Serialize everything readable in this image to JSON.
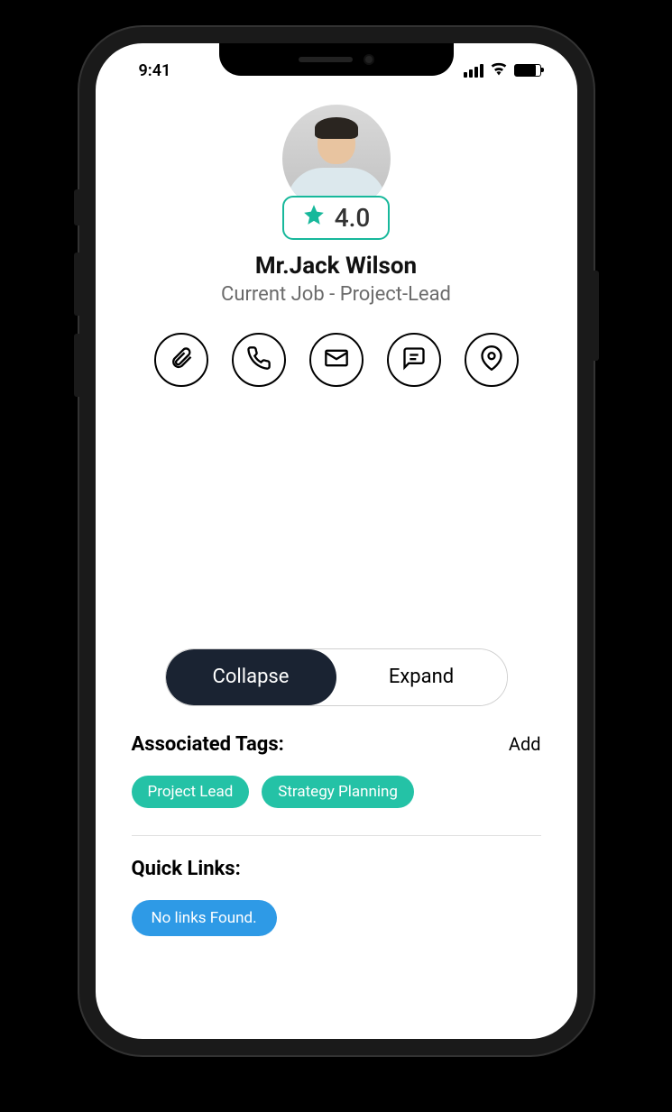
{
  "status_bar": {
    "time": "9:41"
  },
  "profile": {
    "name": "Mr.Jack Wilson",
    "job": "Current Job - Project-Lead",
    "rating": "4.0"
  },
  "actions": {
    "attach": "attach",
    "call": "call",
    "email": "email",
    "message": "message",
    "location": "location"
  },
  "toggle": {
    "collapse": "Collapse",
    "expand": "Expand"
  },
  "tags": {
    "title": "Associated Tags:",
    "action": "Add",
    "items": [
      "Project Lead",
      "Strategy Planning"
    ]
  },
  "quick_links": {
    "title": "Quick Links:",
    "empty": "No links Found."
  }
}
